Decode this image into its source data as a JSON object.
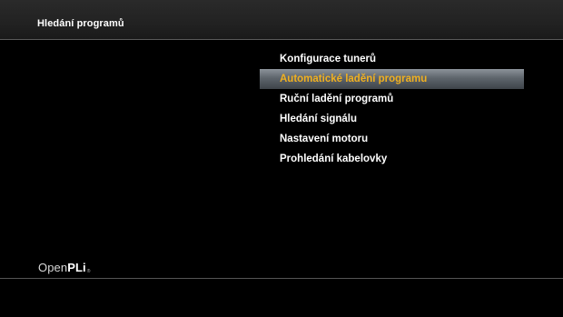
{
  "header": {
    "title": "Hledání programů"
  },
  "menu": {
    "selected_index": 1,
    "items": [
      {
        "label": "Konfigurace tunerů"
      },
      {
        "label": "Automatické ladění programu"
      },
      {
        "label": "Ruční ladění programů"
      },
      {
        "label": "Hledání signálu"
      },
      {
        "label": "Nastavení motoru"
      },
      {
        "label": "Prohledání kabelovky"
      }
    ]
  },
  "logo": {
    "text_light": "Open",
    "text_bold": "PLi",
    "mark": "®"
  },
  "colors": {
    "background": "#000000",
    "text": "#ffffff",
    "selected_text": "#f0b020",
    "selected_bar": "#5e656c"
  }
}
